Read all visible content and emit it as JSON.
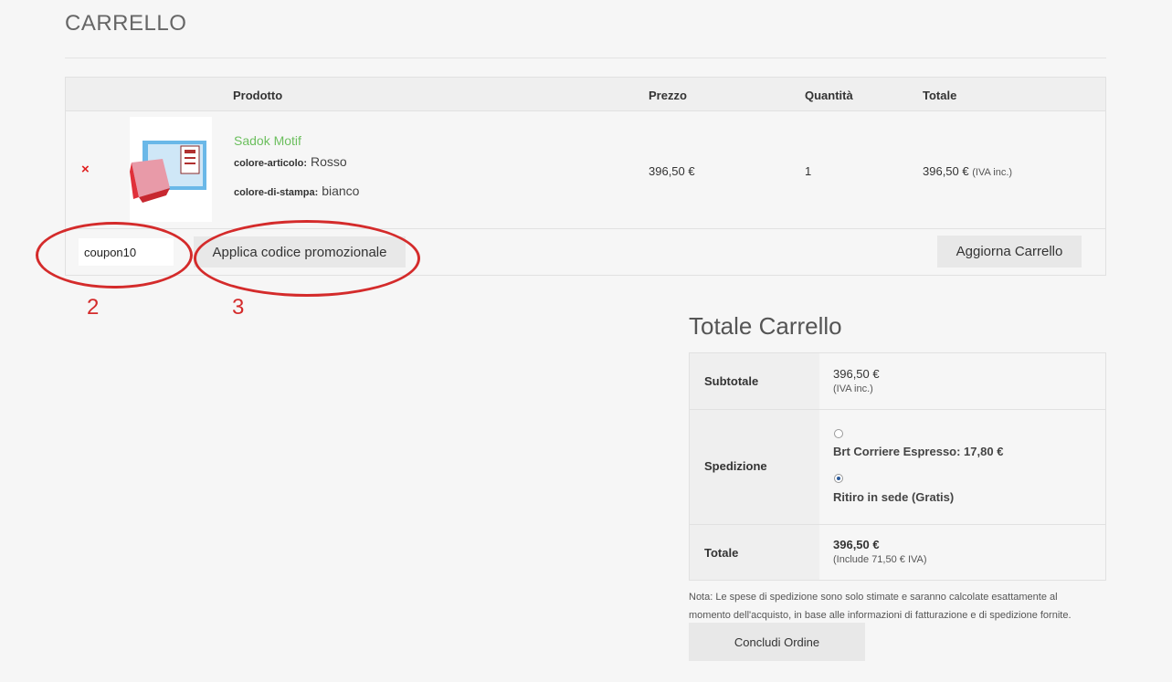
{
  "page": {
    "title": "CARRELLO"
  },
  "cart": {
    "headers": {
      "product": "Prodotto",
      "price": "Prezzo",
      "quantity": "Quantità",
      "total": "Totale"
    },
    "item": {
      "remove_symbol": "×",
      "name": "Sadok Motif",
      "attr1_label": "colore-articolo:",
      "attr1_value": "Rosso",
      "attr2_label": "colore-di-stampa:",
      "attr2_value": "bianco",
      "price": "396,50 €",
      "quantity": "1",
      "total": "396,50 €",
      "total_note": "(IVA inc.)"
    },
    "coupon_value": "coupon10",
    "apply_label": "Applica codice promozionale",
    "update_label": "Aggiorna Carrello"
  },
  "annotations": {
    "n2": "2",
    "n3": "3"
  },
  "totals": {
    "title": "Totale Carrello",
    "subtotal_label": "Subtotale",
    "subtotal_value": "396,50 €",
    "subtotal_note": "(IVA inc.)",
    "shipping_label": "Spedizione",
    "shipping_options": [
      {
        "label": "Brt Corriere Espresso: 17,80 €",
        "selected": false
      },
      {
        "label": "Ritiro in sede (Gratis)",
        "selected": true
      }
    ],
    "total_label": "Totale",
    "total_value": "396,50 €",
    "total_note": "(Include 71,50 € IVA)",
    "note_line1": "Nota: Le spese di spedizione sono solo stimate e saranno calcolate esattamente al",
    "note_line2": "momento dell'acquisto, in base alle informazioni di fatturazione e di spedizione fornite.",
    "checkout_label": "Concludi Ordine"
  },
  "colors": {
    "annotation": "#d42b2b",
    "link": "#6cbf5e",
    "remove": "#e02020"
  }
}
